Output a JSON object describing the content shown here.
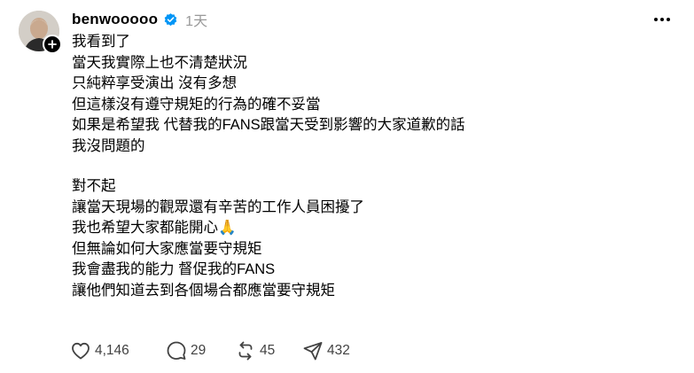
{
  "post": {
    "username": "benwooooo",
    "timestamp": "1天",
    "lines_part1": [
      "我看到了",
      "當天我實際上也不清楚狀況",
      "只純粹享受演出 沒有多想",
      "但這樣沒有遵守規矩的行為的確不妥當",
      "如果是希望我 代替我的FANS跟當天受到影響的大家道歉的話",
      "我沒問題的"
    ],
    "lines_part2": [
      "對不起",
      "讓當天現場的觀眾還有辛苦的工作人員困擾了",
      "我也希望大家都能開心🙏",
      "但無論如何大家應當要守規矩",
      "我會盡我的能力 督促我的FANS",
      "讓他們知道去到各個場合都應當要守規矩"
    ]
  },
  "actions": {
    "likes": "4,146",
    "replies": "29",
    "reposts": "45",
    "shares": "432"
  },
  "icons": {
    "verified": "verified-badge-icon",
    "more": "more-options-icon",
    "follow": "plus-icon",
    "like": "heart-icon",
    "reply": "comment-bubble-icon",
    "repost": "repost-arrows-icon",
    "share": "send-arrow-icon"
  },
  "colors": {
    "text": "#000000",
    "muted": "#999999",
    "action": "#424242",
    "verified": "#0095f6"
  }
}
